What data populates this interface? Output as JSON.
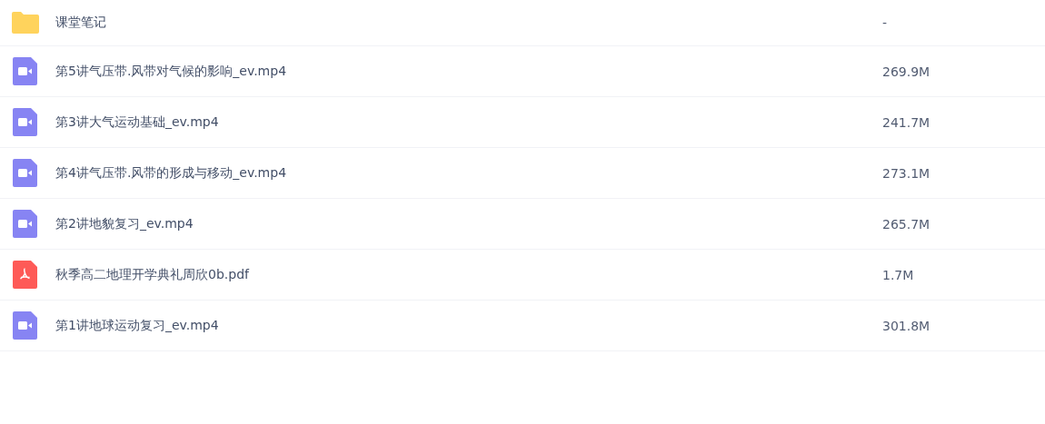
{
  "files": [
    {
      "kind": "folder",
      "name": "课堂笔记",
      "size": "-"
    },
    {
      "kind": "video",
      "name": "第5讲气压带.风带对气候的影响_ev.mp4",
      "size": "269.9M"
    },
    {
      "kind": "video",
      "name": "第3讲大气运动基础_ev.mp4",
      "size": "241.7M"
    },
    {
      "kind": "video",
      "name": "第4讲气压带.风带的形成与移动_ev.mp4",
      "size": "273.1M"
    },
    {
      "kind": "video",
      "name": "第2讲地貌复习_ev.mp4",
      "size": "265.7M"
    },
    {
      "kind": "pdf",
      "name": "秋季高二地理开学典礼周欣0b.pdf",
      "size": "1.7M"
    },
    {
      "kind": "video",
      "name": "第1讲地球运动复习_ev.mp4",
      "size": "301.8M"
    }
  ]
}
